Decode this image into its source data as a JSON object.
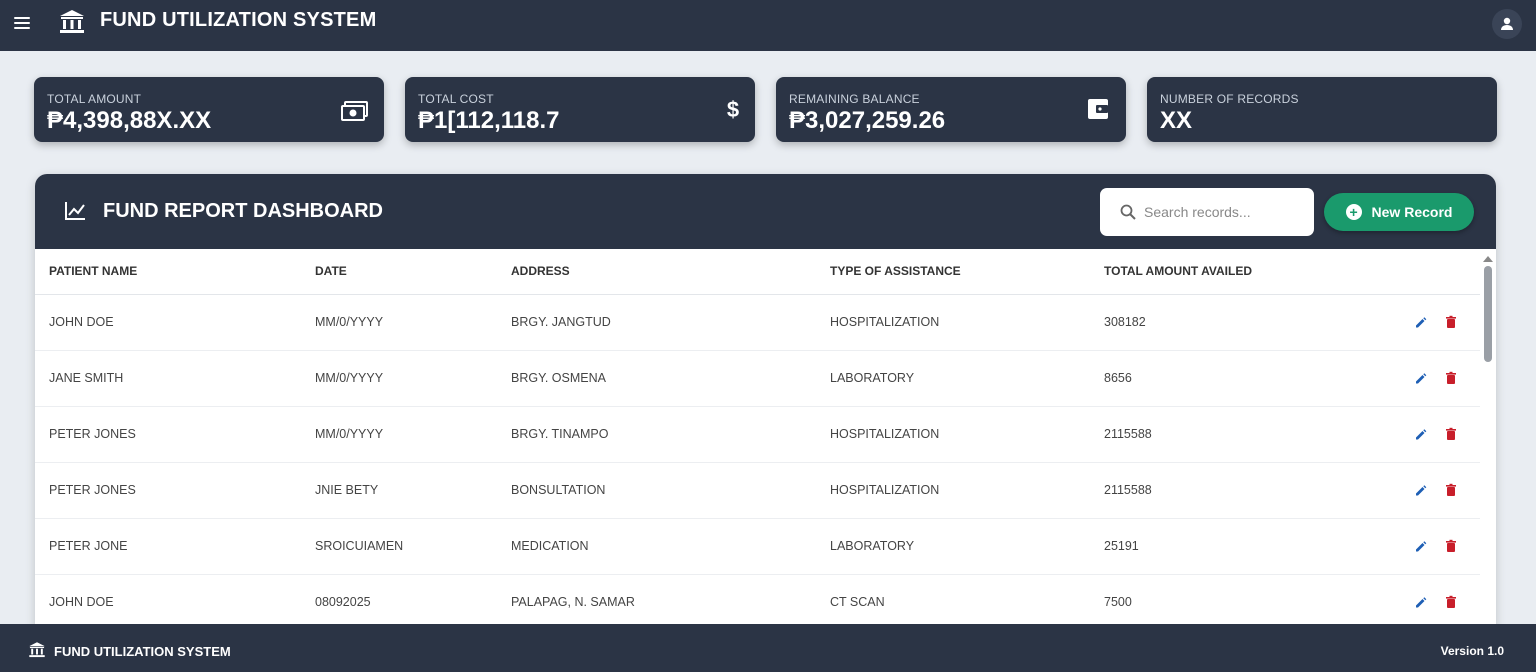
{
  "header": {
    "title": "FUND UTILIZATION SYSTEM"
  },
  "stats": [
    {
      "label": "TOTAL AMOUNT",
      "value": "₱4,398,88X.XX",
      "icon": "cash-icon"
    },
    {
      "label": "TOTAL COST",
      "value": "₱1[112,118.7",
      "icon": "dollar-icon"
    },
    {
      "label": "REMAINING BALANCE",
      "value": "₱3,027,259.26",
      "icon": "wallet-icon"
    },
    {
      "label": "NUMBER OF RECORDS",
      "value": "XX",
      "icon": ""
    }
  ],
  "dashboard": {
    "title": "FUND REPORT DASHBOARD",
    "search_placeholder": "Search records...",
    "new_record_label": "New Record",
    "columns": [
      "PATIENT NAME",
      "DATE",
      "ADDRESS",
      "TYPE OF ASSISTANCE",
      "TOTAL AMOUNT AVAILED"
    ],
    "rows": [
      [
        "JOHN DOE",
        "MM/0/YYYY",
        "BRGY. JANGTUD",
        "HOSPITALIZATION",
        "308182"
      ],
      [
        "JANE SMITH",
        "MM/0/YYYY",
        "BRGY. OSMENA",
        "LABORATORY",
        "8656"
      ],
      [
        "PETER JONES",
        "MM/0/YYYY",
        "BRGY. TINAMPO",
        "HOSPITALIZATION",
        "2115588"
      ],
      [
        "PETER JONES",
        "JNIE BETY",
        "BONSULTATION",
        "HOSPITALIZATION",
        "2115588"
      ],
      [
        "PETER JONE",
        "SROICUIAMEN",
        "MEDICATION",
        "LABORATORY",
        "25191"
      ],
      [
        "JOHN DOE",
        "08092025",
        "PALAPAG, N. SAMAR",
        "CT SCAN",
        "7500"
      ]
    ]
  },
  "footer": {
    "title": "FUND UTILIZATION SYSTEM",
    "version": "Version 1.0"
  },
  "colors": {
    "header_bg": "#2b3445",
    "accent_green": "#1a9a6c",
    "edit_blue": "#1e5fb5",
    "delete_red": "#c81e2a"
  }
}
